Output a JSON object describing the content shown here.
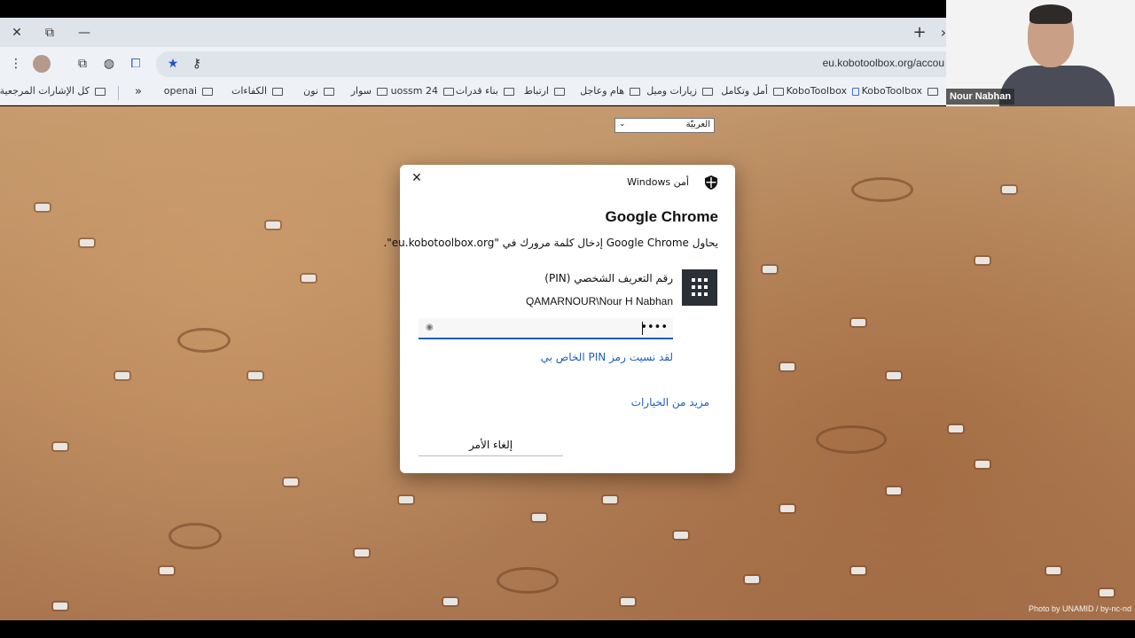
{
  "browser": {
    "tabstrip": {
      "close_glyph": "✕",
      "restore_glyph": "⧉",
      "minimize_glyph": "—",
      "new_tab_glyph": "+",
      "scroll_glyph": "›"
    },
    "address_bar": {
      "url": "eu.kobotoolbox.org/accou"
    },
    "bookmarks": [
      {
        "label": "KoboToolbox",
        "icon": "folder-icon"
      },
      {
        "label": "KoboToolbox",
        "icon": "kobo-icon"
      },
      {
        "label": "أمل وتكامل",
        "icon": "folder-icon"
      },
      {
        "label": "زيارات وميل",
        "icon": "folder-icon"
      },
      {
        "label": "هام وعاجل",
        "icon": "folder-icon"
      },
      {
        "label": "ارتباط",
        "icon": "folder-icon"
      },
      {
        "label": "بناء قدرات",
        "icon": "folder-icon"
      },
      {
        "label": "uossm 24",
        "icon": "folder-icon"
      },
      {
        "label": "سوار",
        "icon": "folder-icon"
      },
      {
        "label": "نون",
        "icon": "folder-icon"
      },
      {
        "label": "الكفاءات",
        "icon": "folder-icon"
      },
      {
        "label": "openai",
        "icon": "folder-icon"
      }
    ],
    "more_bookmarks_glyph": "«",
    "all_bookmarks": "كل الإشارات المرجعية"
  },
  "video": {
    "participant_name": "Nour Nabhan"
  },
  "page": {
    "language_select": "العربيّة",
    "photo_credit": "Photo by UNAMID / by-nc-nd"
  },
  "dialog": {
    "brand": "أمن Windows",
    "title": "Google Chrome",
    "message": "يحاول Google Chrome إدخال كلمة مرورك في \"eu.kobotoolbox.org\".",
    "pin_label": "رقم التعريف الشخصي (PIN)",
    "pin_user": "QAMARNOUR\\Nour H Nabhan",
    "pin_value": "••••",
    "forgot_pin": "لقد نسيت رمز PIN الخاص بي",
    "more_options": "مزيد من الخيارات",
    "cancel": "إلغاء الأمر",
    "close_glyph": "✕"
  }
}
